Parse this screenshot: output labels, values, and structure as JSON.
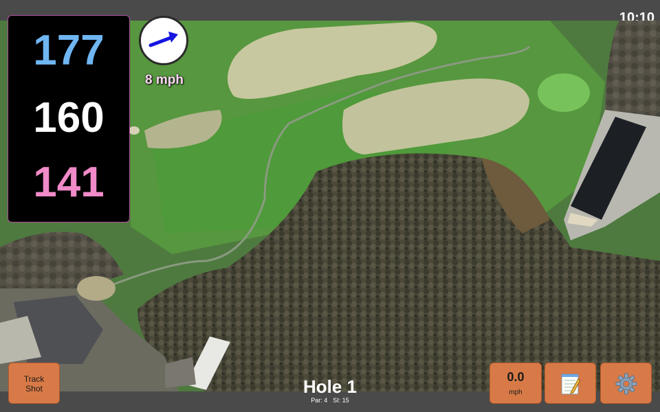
{
  "status_bar": {
    "time": "10:10"
  },
  "distances": {
    "back": "177",
    "middle": "160",
    "front": "141",
    "colors": {
      "back": "#6fb6f2",
      "middle": "#ffffff",
      "front": "#f08ac8"
    }
  },
  "wind": {
    "speed_label": "8 mph",
    "arrow_icon": "wind-direction-arrow-icon"
  },
  "hole": {
    "title": "Hole 1",
    "par": "Par: 4",
    "si": "SI: 15"
  },
  "buttons": {
    "track_shot": "Track Shot",
    "speed_value": "0.0",
    "speed_unit": "mph",
    "notes_icon": "notepad-icon",
    "settings_icon": "gear-icon"
  },
  "colors": {
    "button_accent": "#d87a47",
    "panel_border": "#b04fa0",
    "bar_bg": "#4a4a4a"
  }
}
